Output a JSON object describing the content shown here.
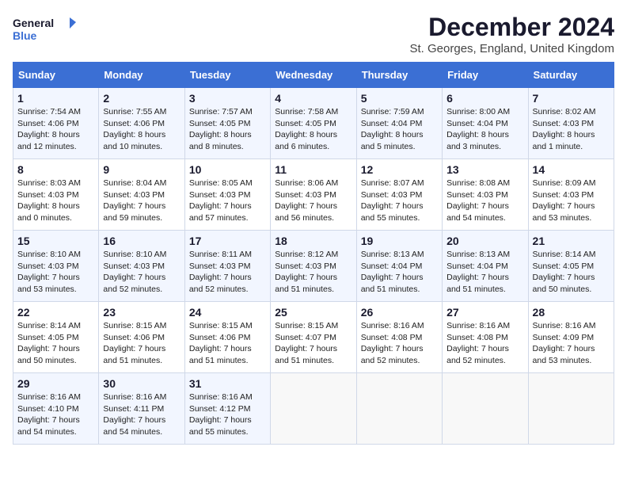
{
  "header": {
    "logo_line1": "General",
    "logo_line2": "Blue",
    "month_title": "December 2024",
    "subtitle": "St. Georges, England, United Kingdom"
  },
  "weekdays": [
    "Sunday",
    "Monday",
    "Tuesday",
    "Wednesday",
    "Thursday",
    "Friday",
    "Saturday"
  ],
  "weeks": [
    [
      {
        "day": "1",
        "sunrise": "Sunrise: 7:54 AM",
        "sunset": "Sunset: 4:06 PM",
        "daylight": "Daylight: 8 hours and 12 minutes."
      },
      {
        "day": "2",
        "sunrise": "Sunrise: 7:55 AM",
        "sunset": "Sunset: 4:06 PM",
        "daylight": "Daylight: 8 hours and 10 minutes."
      },
      {
        "day": "3",
        "sunrise": "Sunrise: 7:57 AM",
        "sunset": "Sunset: 4:05 PM",
        "daylight": "Daylight: 8 hours and 8 minutes."
      },
      {
        "day": "4",
        "sunrise": "Sunrise: 7:58 AM",
        "sunset": "Sunset: 4:05 PM",
        "daylight": "Daylight: 8 hours and 6 minutes."
      },
      {
        "day": "5",
        "sunrise": "Sunrise: 7:59 AM",
        "sunset": "Sunset: 4:04 PM",
        "daylight": "Daylight: 8 hours and 5 minutes."
      },
      {
        "day": "6",
        "sunrise": "Sunrise: 8:00 AM",
        "sunset": "Sunset: 4:04 PM",
        "daylight": "Daylight: 8 hours and 3 minutes."
      },
      {
        "day": "7",
        "sunrise": "Sunrise: 8:02 AM",
        "sunset": "Sunset: 4:03 PM",
        "daylight": "Daylight: 8 hours and 1 minute."
      }
    ],
    [
      {
        "day": "8",
        "sunrise": "Sunrise: 8:03 AM",
        "sunset": "Sunset: 4:03 PM",
        "daylight": "Daylight: 8 hours and 0 minutes."
      },
      {
        "day": "9",
        "sunrise": "Sunrise: 8:04 AM",
        "sunset": "Sunset: 4:03 PM",
        "daylight": "Daylight: 7 hours and 59 minutes."
      },
      {
        "day": "10",
        "sunrise": "Sunrise: 8:05 AM",
        "sunset": "Sunset: 4:03 PM",
        "daylight": "Daylight: 7 hours and 57 minutes."
      },
      {
        "day": "11",
        "sunrise": "Sunrise: 8:06 AM",
        "sunset": "Sunset: 4:03 PM",
        "daylight": "Daylight: 7 hours and 56 minutes."
      },
      {
        "day": "12",
        "sunrise": "Sunrise: 8:07 AM",
        "sunset": "Sunset: 4:03 PM",
        "daylight": "Daylight: 7 hours and 55 minutes."
      },
      {
        "day": "13",
        "sunrise": "Sunrise: 8:08 AM",
        "sunset": "Sunset: 4:03 PM",
        "daylight": "Daylight: 7 hours and 54 minutes."
      },
      {
        "day": "14",
        "sunrise": "Sunrise: 8:09 AM",
        "sunset": "Sunset: 4:03 PM",
        "daylight": "Daylight: 7 hours and 53 minutes."
      }
    ],
    [
      {
        "day": "15",
        "sunrise": "Sunrise: 8:10 AM",
        "sunset": "Sunset: 4:03 PM",
        "daylight": "Daylight: 7 hours and 53 minutes."
      },
      {
        "day": "16",
        "sunrise": "Sunrise: 8:10 AM",
        "sunset": "Sunset: 4:03 PM",
        "daylight": "Daylight: 7 hours and 52 minutes."
      },
      {
        "day": "17",
        "sunrise": "Sunrise: 8:11 AM",
        "sunset": "Sunset: 4:03 PM",
        "daylight": "Daylight: 7 hours and 52 minutes."
      },
      {
        "day": "18",
        "sunrise": "Sunrise: 8:12 AM",
        "sunset": "Sunset: 4:03 PM",
        "daylight": "Daylight: 7 hours and 51 minutes."
      },
      {
        "day": "19",
        "sunrise": "Sunrise: 8:13 AM",
        "sunset": "Sunset: 4:04 PM",
        "daylight": "Daylight: 7 hours and 51 minutes."
      },
      {
        "day": "20",
        "sunrise": "Sunrise: 8:13 AM",
        "sunset": "Sunset: 4:04 PM",
        "daylight": "Daylight: 7 hours and 51 minutes."
      },
      {
        "day": "21",
        "sunrise": "Sunrise: 8:14 AM",
        "sunset": "Sunset: 4:05 PM",
        "daylight": "Daylight: 7 hours and 50 minutes."
      }
    ],
    [
      {
        "day": "22",
        "sunrise": "Sunrise: 8:14 AM",
        "sunset": "Sunset: 4:05 PM",
        "daylight": "Daylight: 7 hours and 50 minutes."
      },
      {
        "day": "23",
        "sunrise": "Sunrise: 8:15 AM",
        "sunset": "Sunset: 4:06 PM",
        "daylight": "Daylight: 7 hours and 51 minutes."
      },
      {
        "day": "24",
        "sunrise": "Sunrise: 8:15 AM",
        "sunset": "Sunset: 4:06 PM",
        "daylight": "Daylight: 7 hours and 51 minutes."
      },
      {
        "day": "25",
        "sunrise": "Sunrise: 8:15 AM",
        "sunset": "Sunset: 4:07 PM",
        "daylight": "Daylight: 7 hours and 51 minutes."
      },
      {
        "day": "26",
        "sunrise": "Sunrise: 8:16 AM",
        "sunset": "Sunset: 4:08 PM",
        "daylight": "Daylight: 7 hours and 52 minutes."
      },
      {
        "day": "27",
        "sunrise": "Sunrise: 8:16 AM",
        "sunset": "Sunset: 4:08 PM",
        "daylight": "Daylight: 7 hours and 52 minutes."
      },
      {
        "day": "28",
        "sunrise": "Sunrise: 8:16 AM",
        "sunset": "Sunset: 4:09 PM",
        "daylight": "Daylight: 7 hours and 53 minutes."
      }
    ],
    [
      {
        "day": "29",
        "sunrise": "Sunrise: 8:16 AM",
        "sunset": "Sunset: 4:10 PM",
        "daylight": "Daylight: 7 hours and 54 minutes."
      },
      {
        "day": "30",
        "sunrise": "Sunrise: 8:16 AM",
        "sunset": "Sunset: 4:11 PM",
        "daylight": "Daylight: 7 hours and 54 minutes."
      },
      {
        "day": "31",
        "sunrise": "Sunrise: 8:16 AM",
        "sunset": "Sunset: 4:12 PM",
        "daylight": "Daylight: 7 hours and 55 minutes."
      },
      null,
      null,
      null,
      null
    ]
  ]
}
